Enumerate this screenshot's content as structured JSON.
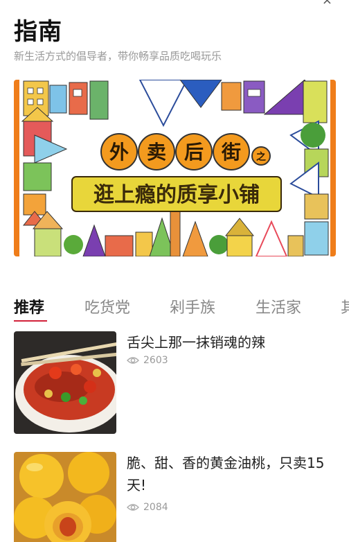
{
  "header": {
    "title": "指南",
    "subtitle": "新生活方式的倡导者，带你畅享品质吃喝玩乐"
  },
  "banner": {
    "headline_chars": [
      "外",
      "卖",
      "后",
      "街"
    ],
    "headline_suffix": "之",
    "subline": "逛上瘾的质享小铺",
    "colors": {
      "circle": "#f39a1e",
      "subline_bg": "#e8d63a",
      "subline_text": "#3a2a0a",
      "edge": "#ef7d1a"
    }
  },
  "tabs": [
    {
      "label": "推荐",
      "active": true
    },
    {
      "label": "吃货党",
      "active": false
    },
    {
      "label": "剁手族",
      "active": false
    },
    {
      "label": "生活家",
      "active": false
    },
    {
      "label": "其",
      "active": false
    }
  ],
  "articles": [
    {
      "title": "舌尖上那一抹销魂的辣",
      "views": "2603",
      "thumb": "chili-noodles"
    },
    {
      "title": "脆、甜、香的黄金油桃，只卖15天!",
      "views": "2084",
      "thumb": "golden-peaches"
    }
  ],
  "icons": {
    "views": "eye-icon",
    "close": "close-icon"
  },
  "accent_color": "#d2213a"
}
